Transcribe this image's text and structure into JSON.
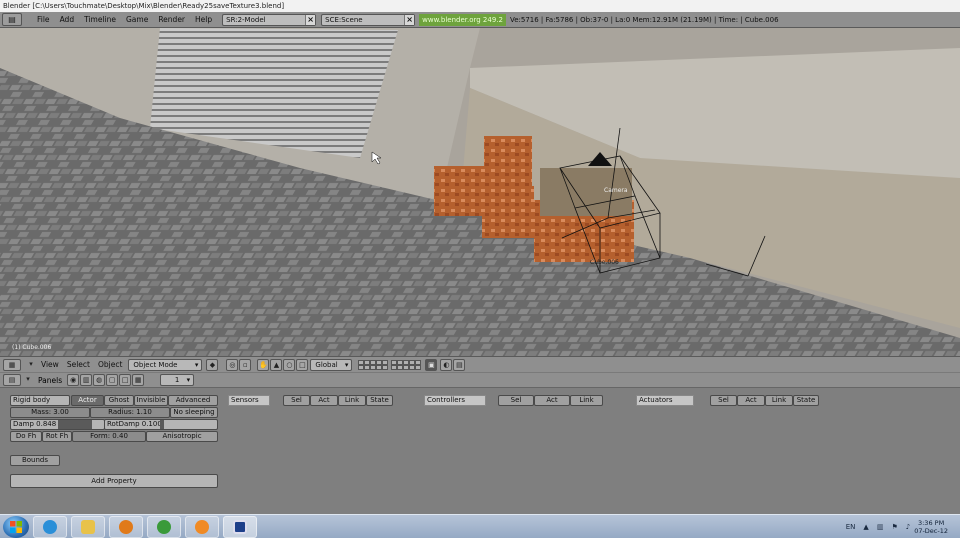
{
  "window": {
    "title": "Blender [C:\\Users\\Touchmate\\Desktop\\Mix\\Blender\\Ready25saveTexture3.blend]"
  },
  "top_header": {
    "menus": [
      "File",
      "Add",
      "Timeline",
      "Game",
      "Render",
      "Help"
    ],
    "screen_field": "SR:2-Model",
    "scene_field": "SCE:Scene",
    "url": "www.blender.org 249.2",
    "stats": "Ve:5716 | Fa:5786 | Ob:37-0 | La:0   Mem:12.91M (21.19M)   | Time:  | Cube.006"
  },
  "viewport": {
    "object_label": "(1) Cube.006",
    "camera_label": "Camera",
    "object_name_label": "Cube.006"
  },
  "view_header": {
    "menus": [
      "View",
      "Select",
      "Object"
    ],
    "mode": "Object Mode",
    "orientation": "Global"
  },
  "buttons_header": {
    "panels_label": "Panels",
    "frame": "1"
  },
  "physics": {
    "type": "Rigid body",
    "toggles": [
      "Actor",
      "Ghost",
      "Invisible",
      "Advanced"
    ],
    "mass": "Mass: 3.00",
    "radius": "Radius: 1.10",
    "no_sleeping": "No sleeping",
    "damp": "Damp 0.848",
    "rotdamp": "RotDamp 0.100",
    "do_fh": "Do Fh",
    "rot_fh": "Rot Fh",
    "form": "Form: 0.40",
    "anisotropic": "Anisotropic",
    "bounds": "Bounds",
    "add_property": "Add Property"
  },
  "logic": {
    "sensors": "Sensors",
    "controllers": "Controllers",
    "actuators": "Actuators",
    "filter_sel": "Sel",
    "filter_act": "Act",
    "filter_link": "Link",
    "filter_state": "State"
  },
  "taskbar": {
    "lang": "EN",
    "time": "3:36 PM",
    "date": "07-Dec-12"
  },
  "colors": {
    "url_bg": "#6ea33d",
    "panel_bg": "#7f7f7f",
    "header_bg": "#8f8f8f"
  }
}
